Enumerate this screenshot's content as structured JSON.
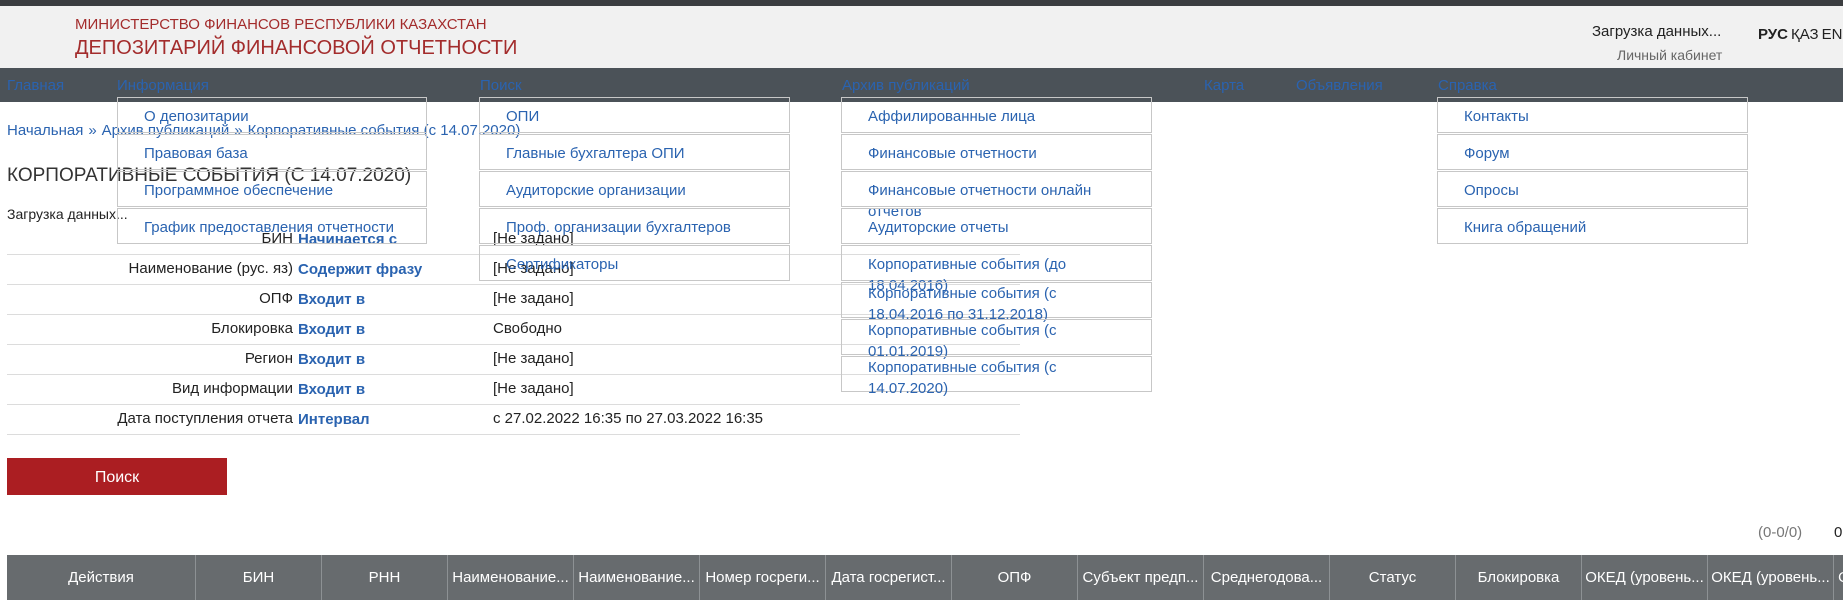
{
  "header": {
    "org_top": "МИНИСТЕРСТВО ФИНАНСОВ РЕСПУБЛИКИ КАЗАХСТАН",
    "org_main": "ДЕПОЗИТАРИЙ ФИНАНСОВОЙ ОТЧЕТНОСТИ",
    "loading": "Загрузка данных...",
    "cabinet": "Личный кабинет",
    "languages": [
      "РУС",
      "ҚАЗ",
      "ENG"
    ],
    "active_language": "РУС"
  },
  "nav": {
    "items": [
      "Главная",
      "Информация",
      "Поиск",
      "Архив публикаций",
      "Карта",
      "Объявления",
      "Справка"
    ]
  },
  "menus": {
    "info": [
      "О депозитарии",
      "Правовая база",
      "Программное обеспечение",
      "График предоставления отчетности"
    ],
    "search": [
      "ОПИ",
      "Главные бухгалтера ОПИ",
      "Аудиторские организации",
      "Проф. организации бухгалтеров",
      "Сертификаторы"
    ],
    "archive": [
      "Аффилированные лица",
      "Финансовые отчетности",
      "Финансовые отчетности онлайн отчетов",
      "Аудиторские отчеты",
      "Корпоративные события (до 18.04.2016)",
      "Корпоративные события (с 18.04.2016 по 31.12.2018)",
      "Корпоративные события (с 01.01.2019)",
      "Корпоративные события (с 14.07.2020)"
    ],
    "help": [
      "Контакты",
      "Форум",
      "Опросы",
      "Книга обращений"
    ]
  },
  "breadcrumb": {
    "items": [
      "Начальная",
      "Архив публикаций",
      "Корпоративные события (с 14.07.2020)"
    ],
    "separator": "»"
  },
  "page": {
    "title": "КОРПОРАТИВНЫЕ СОБЫТИЯ (С 14.07.2020)",
    "loading": "Загрузка данных..."
  },
  "filters": [
    {
      "label": "БИН",
      "op": "Начинается с",
      "value": "[Не задано]"
    },
    {
      "label": "Наименование (рус. яз)",
      "op": "Содержит фразу",
      "value": "[Не задано]"
    },
    {
      "label": "ОПФ",
      "op": "Входит в",
      "value": "[Не задано]"
    },
    {
      "label": "Блокировка",
      "op": "Входит в",
      "value": "Свободно"
    },
    {
      "label": "Регион",
      "op": "Входит в",
      "value": "[Не задано]"
    },
    {
      "label": "Вид информации",
      "op": "Входит в",
      "value": "[Не задано]"
    },
    {
      "label": "Дата поступления отчета",
      "op": "Интервал",
      "value": "с 27.02.2022 16:35 по 27.03.2022 16:35"
    }
  ],
  "search_button": "Поиск",
  "pager": {
    "range": "(0-0/0)",
    "count": "0"
  },
  "table": {
    "columns": [
      "Действия",
      "БИН",
      "РНН",
      "Наименование...",
      "Наименование...",
      "Номер госреги...",
      "Дата госрегист...",
      "ОПФ",
      "Субъект предп...",
      "Среднегодова...",
      "Статус",
      "Блокировка",
      "ОКЕД (уровень...",
      "ОКЕД (уровень...",
      "О"
    ]
  },
  "colors": {
    "brand_red": "#a32c2c",
    "button_red": "#ab1e22",
    "link_blue": "#2a63b0",
    "nav_bg": "#4b5258",
    "table_header_bg": "#676b6e"
  }
}
